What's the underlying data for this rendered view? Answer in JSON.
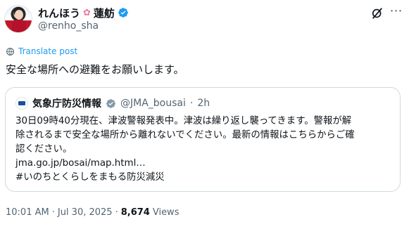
{
  "author": {
    "display_name": "れんほう",
    "lotus_icon": "lotus-icon",
    "display_name_2": "蓮舫",
    "handle": "@renho_sha"
  },
  "translate": {
    "label": "Translate post"
  },
  "post": {
    "text": "安全な場所への避難をお願いします。"
  },
  "quote": {
    "name": "気象庁防災情報",
    "handle": "@JMA_bousai",
    "separator": "·",
    "time": "2h",
    "lines": [
      "30日09時40分現在、津波警報発表中。津波は繰り返し襲ってきます。警報が解",
      "除されるまで安全な場所から離れないでください。最新の情報はこちらからご確",
      "認ください。",
      "jma.go.jp/bosai/map.html…",
      "#いのちとくらしをまもる防災減災"
    ]
  },
  "meta": {
    "time": "10:01 AM",
    "sep1": "·",
    "date": "Jul 30, 2025",
    "sep2": "·",
    "views_count": "8,674",
    "views_label": "Views"
  },
  "colors": {
    "accent": "#1d9bf0",
    "text": "#0f1419",
    "muted": "#536471",
    "border": "#cfd9de"
  }
}
